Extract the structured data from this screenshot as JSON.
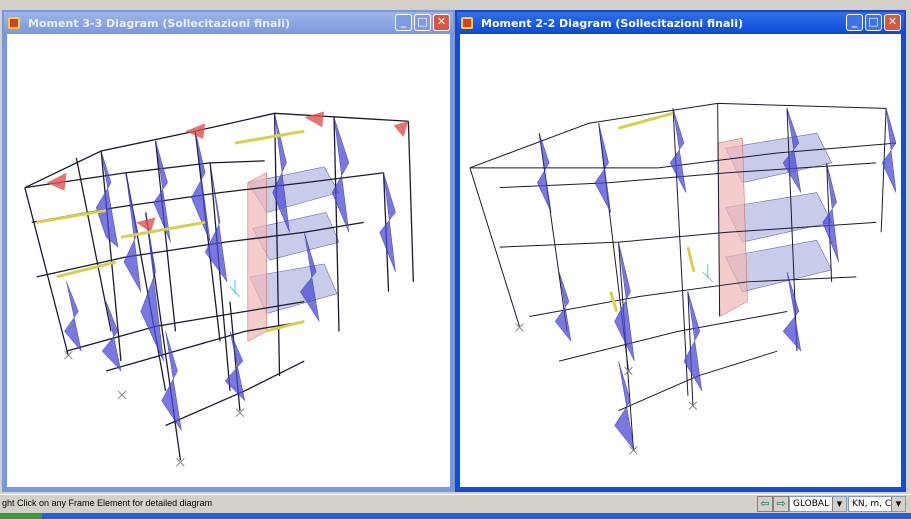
{
  "windows": {
    "left": {
      "title": "Moment 3-3 Diagram   (Sollecitazioni finali)"
    },
    "right": {
      "title": "Moment 2-2 Diagram   (Sollecitazioni finali)"
    }
  },
  "window_controls": {
    "minimize": "_",
    "maximize": "□",
    "close": "✕"
  },
  "statusbar": {
    "message": "ght Click on any Frame Element for detailed diagram",
    "nav_prev": "⇦",
    "nav_next": "⇨",
    "coord_system": "GLOBAL",
    "units": "KN, m, C"
  },
  "colors": {
    "accent": "#0054e3",
    "moment_blue": "#4b4bd6",
    "moment_red": "#e05050",
    "moment_yellow": "#e8e060",
    "slab": "#9aa3d8"
  }
}
